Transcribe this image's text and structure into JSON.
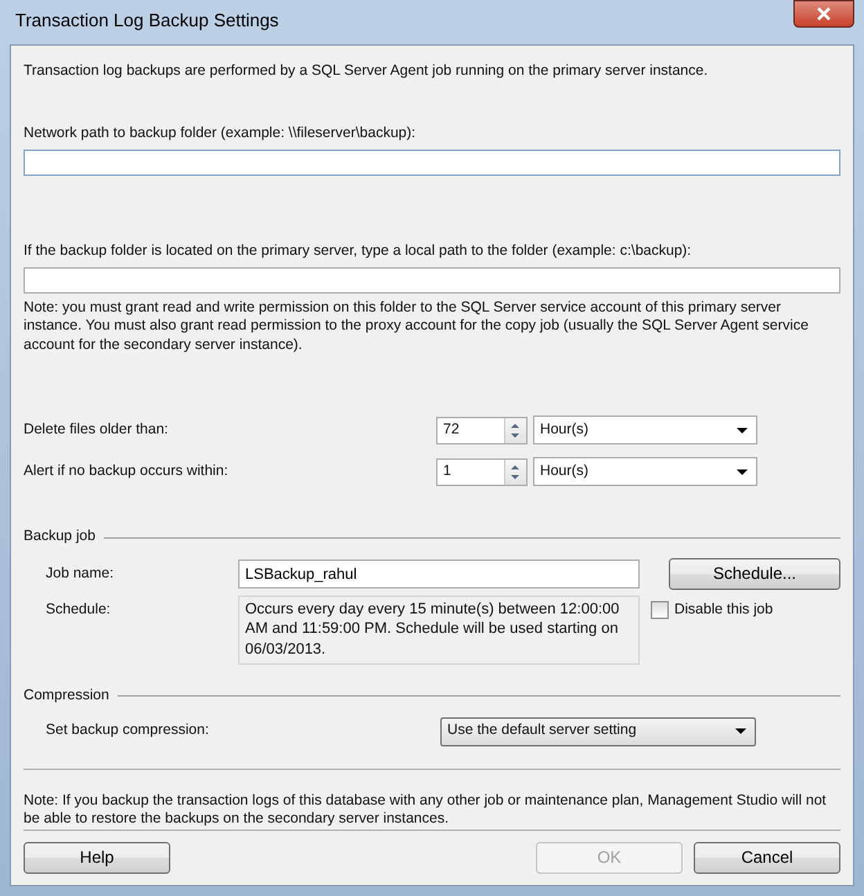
{
  "window": {
    "title": "Transaction Log Backup Settings"
  },
  "intro": "Transaction log backups are performed by a SQL Server Agent job running on the primary server instance.",
  "network_path": {
    "label": "Network path to backup folder (example: \\\\fileserver\\backup):"
  },
  "local_path": {
    "label": "If the backup folder is located on the primary server, type a local path to the folder (example: c:\\backup):"
  },
  "permission_note": "Note: you must grant read and write permission on this folder to the SQL Server service account of this primary server instance.  You must also grant read permission to the proxy account for the copy job (usually the SQL Server Agent service account for the secondary server instance).",
  "retention": [
    {
      "label": "Delete files older than:",
      "value": "72",
      "unit": "Hour(s)"
    },
    {
      "label": "Alert if no backup occurs within:",
      "value": "1",
      "unit": "Hour(s)"
    }
  ],
  "backup_job": {
    "heading": "Backup job",
    "job_name_label": "Job name:",
    "job_name": "LSBackup_rahul",
    "schedule_button": "Schedule...",
    "schedule_label": "Schedule:",
    "schedule": "Occurs every day every 15 minute(s) between 12:00:00 AM and 11:59:00 PM. Schedule will be used starting on 06/03/2013.",
    "disable_job": {
      "label": "Disable this job",
      "checked": false
    }
  },
  "compression": {
    "heading": "Compression",
    "label": "Set backup compression:",
    "value": "Use the default server setting"
  },
  "footer_note": "Note: If you backup the transaction logs of this database with any other job or maintenance plan, Management Studio will not be able to restore the backups on the secondary server instances.",
  "buttons": [
    {
      "label": "Help",
      "disabled": false
    },
    {
      "label": "OK",
      "disabled": true
    },
    {
      "label": "Cancel",
      "disabled": false
    }
  ]
}
